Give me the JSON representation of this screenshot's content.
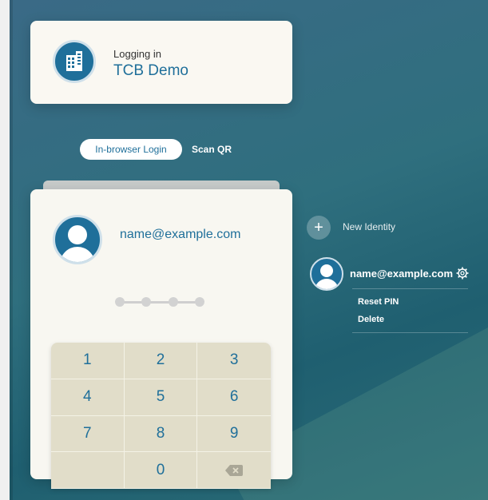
{
  "login_card": {
    "label": "Logging in",
    "organization": "TCB Demo",
    "org_icon": "building-icon"
  },
  "tabs": [
    {
      "label": "In-browser Login",
      "active": true
    },
    {
      "label": "Scan QR",
      "active": false
    }
  ],
  "pin_card": {
    "email": "name@example.com",
    "pin_length": 4,
    "keypad": [
      "1",
      "2",
      "3",
      "4",
      "5",
      "6",
      "7",
      "8",
      "9",
      "",
      "0",
      "backspace"
    ]
  },
  "sidebar": {
    "new_identity_label": "New Identity",
    "identity_email": "name@example.com",
    "menu": [
      "Reset PIN",
      "Delete"
    ]
  },
  "colors": {
    "accent": "#1f6f9a",
    "card_bg": "#faf8f2",
    "keypad_bg": "#e1ddc9",
    "background": "#2f6f7e"
  }
}
